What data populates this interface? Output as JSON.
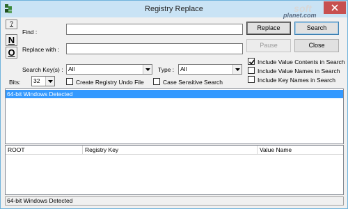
{
  "window": {
    "title": "Registry Replace",
    "watermark": "soft",
    "watermark_sub": "planet.com"
  },
  "side_buttons": {
    "help": "?",
    "n": "N",
    "o": "O"
  },
  "find": {
    "label": "Find :",
    "value": ""
  },
  "replace_with": {
    "label": "Replace with :",
    "value": ""
  },
  "buttons": {
    "replace": "Replace",
    "search": "Search",
    "pause": "Pause",
    "close": "Close"
  },
  "search_keys": {
    "label": "Search Key(s) :",
    "value": "All"
  },
  "type": {
    "label": "Type :",
    "value": "All"
  },
  "bits": {
    "label": "Bits:",
    "value": "32"
  },
  "options": {
    "create_undo": {
      "label": "Create Registry Undo File",
      "checked": false
    },
    "case_sensitive": {
      "label": "Case Sensitive Search",
      "checked": false
    },
    "include_value_contents": {
      "label": "Include Value Contents in Search",
      "checked": true
    },
    "include_value_names": {
      "label": "Include Value Names in Search",
      "checked": false
    },
    "include_key_names": {
      "label": "Include Key Names in Search",
      "checked": false
    }
  },
  "results": {
    "lines": [
      "64-bit Windows Detected"
    ]
  },
  "table": {
    "columns": [
      "ROOT",
      "Registry Key",
      "Value Name"
    ]
  },
  "status": "64-bit Windows Detected",
  "colors": {
    "selection": "#3399ff",
    "titlebar": "#c9e3f5",
    "close": "#c75050"
  }
}
